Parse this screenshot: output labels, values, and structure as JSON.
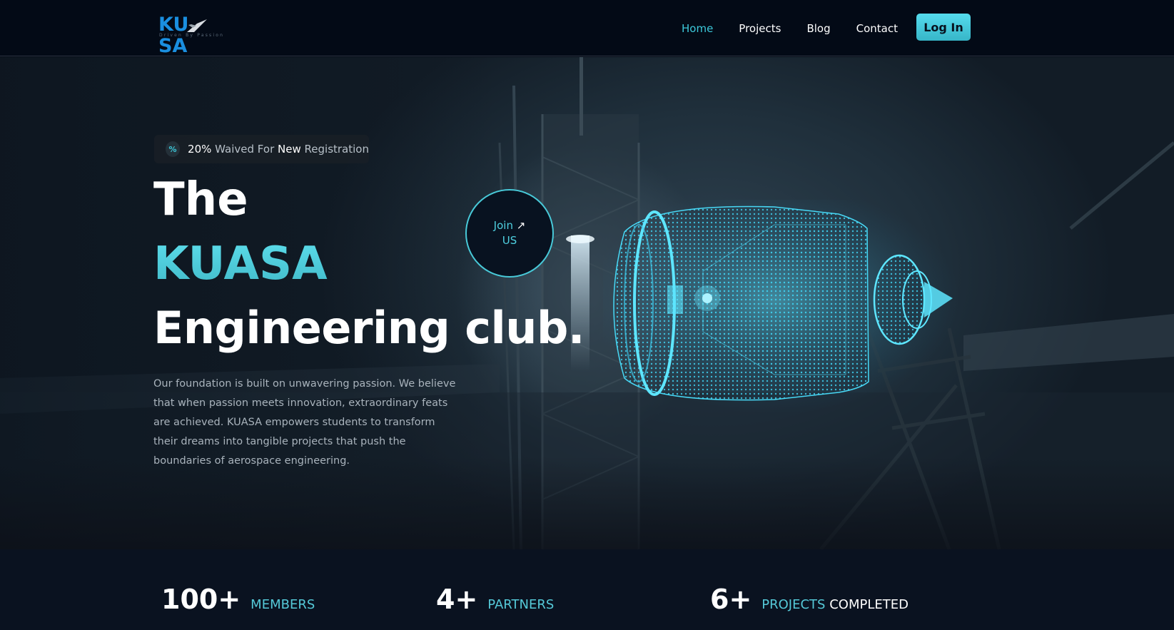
{
  "nav": {
    "logo_text_left": "KU",
    "logo_text_right": "SA",
    "logo_tagline": "Driven By Passion",
    "links": [
      {
        "label": "Home",
        "active": true
      },
      {
        "label": "Projects",
        "active": false
      },
      {
        "label": "Blog",
        "active": false
      },
      {
        "label": "Contact",
        "active": false
      }
    ],
    "login_label": "Log In"
  },
  "hero": {
    "promo": {
      "icon": "percent-icon",
      "percent": "20%",
      "text_a": "Waived For",
      "highlight": "New",
      "text_b": "Registration"
    },
    "title_line1": "The",
    "title_line2": "KUASA",
    "title_line3": "Engineering club.",
    "description": "Our foundation is built on unwavering passion. We believe that when passion meets innovation, extraordinary feats are achieved. KUASA empowers students to transform their dreams into tangible projects that push the boundaries of aerospace engineering.",
    "join": {
      "line1": "Join",
      "line2": "US",
      "icon": "arrow-up-right-icon"
    }
  },
  "stats": [
    {
      "number": "100+",
      "label": "MEMBERS",
      "label_white": ""
    },
    {
      "number": "4+",
      "label": "PARTNERS",
      "label_white": ""
    },
    {
      "number": "6+",
      "label": "PROJECTS",
      "label_white": "COMPLETED"
    }
  ],
  "colors": {
    "accent": "#3cc8da",
    "background": "#030a16",
    "brand_blue": "#1a8fe0"
  }
}
